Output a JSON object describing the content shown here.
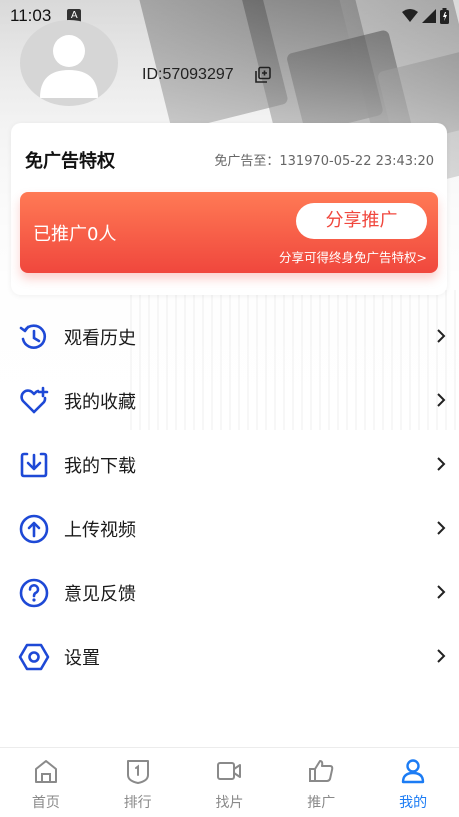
{
  "status_bar": {
    "time": "11:03",
    "notif_glyph": "A"
  },
  "profile": {
    "uid": "ID:57093297"
  },
  "vip": {
    "title": "免广告特权",
    "expire": "免广告至：131970-05-22 23:43:20",
    "promo_count": "已推广0人",
    "share_button": "分享推广",
    "promo_sub": "分享可得终身免广告特权>"
  },
  "menu": [
    {
      "label": "观看历史",
      "icon": "history-icon"
    },
    {
      "label": "我的收藏",
      "icon": "heart-plus-icon"
    },
    {
      "label": "我的下载",
      "icon": "download-icon"
    },
    {
      "label": "上传视频",
      "icon": "upload-icon"
    },
    {
      "label": "意见反馈",
      "icon": "question-icon"
    },
    {
      "label": "设置",
      "icon": "settings-icon"
    }
  ],
  "bottom_nav": [
    {
      "label": "首页",
      "icon": "home-icon"
    },
    {
      "label": "排行",
      "icon": "ranking-icon"
    },
    {
      "label": "找片",
      "icon": "video-camera-icon"
    },
    {
      "label": "推广",
      "icon": "thumbs-up-icon"
    },
    {
      "label": "我的",
      "icon": "person-icon",
      "active": true
    }
  ],
  "colors": {
    "accent_blue": "#1c7cf4",
    "menu_icon_blue": "#1e49d6",
    "promo_red": "#f0473d",
    "promo_orange": "#ff7a55",
    "nav_inactive": "#8a8a8a"
  }
}
